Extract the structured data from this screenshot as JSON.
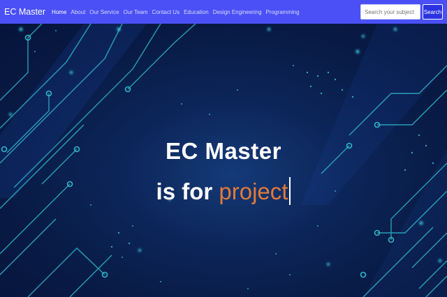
{
  "navbar": {
    "brand": "EC Master",
    "links": [
      {
        "label": "Home",
        "active": true
      },
      {
        "label": "About"
      },
      {
        "label": "Our Service"
      },
      {
        "label": "Our Team"
      },
      {
        "label": "Contact Us"
      },
      {
        "label": "Education"
      },
      {
        "label": "Design Engineering"
      },
      {
        "label": "Programming"
      }
    ],
    "search": {
      "placeholder": "Search your subject",
      "button_label": "Search"
    }
  },
  "hero": {
    "title": "EC Master",
    "subtitle_prefix": "is for",
    "typed_word": "project"
  },
  "colors": {
    "navbar": "#4a50f5",
    "hero_bg": "#0c2558",
    "accent_typed": "#e07a3a",
    "circuit": "#2fb5c9"
  }
}
